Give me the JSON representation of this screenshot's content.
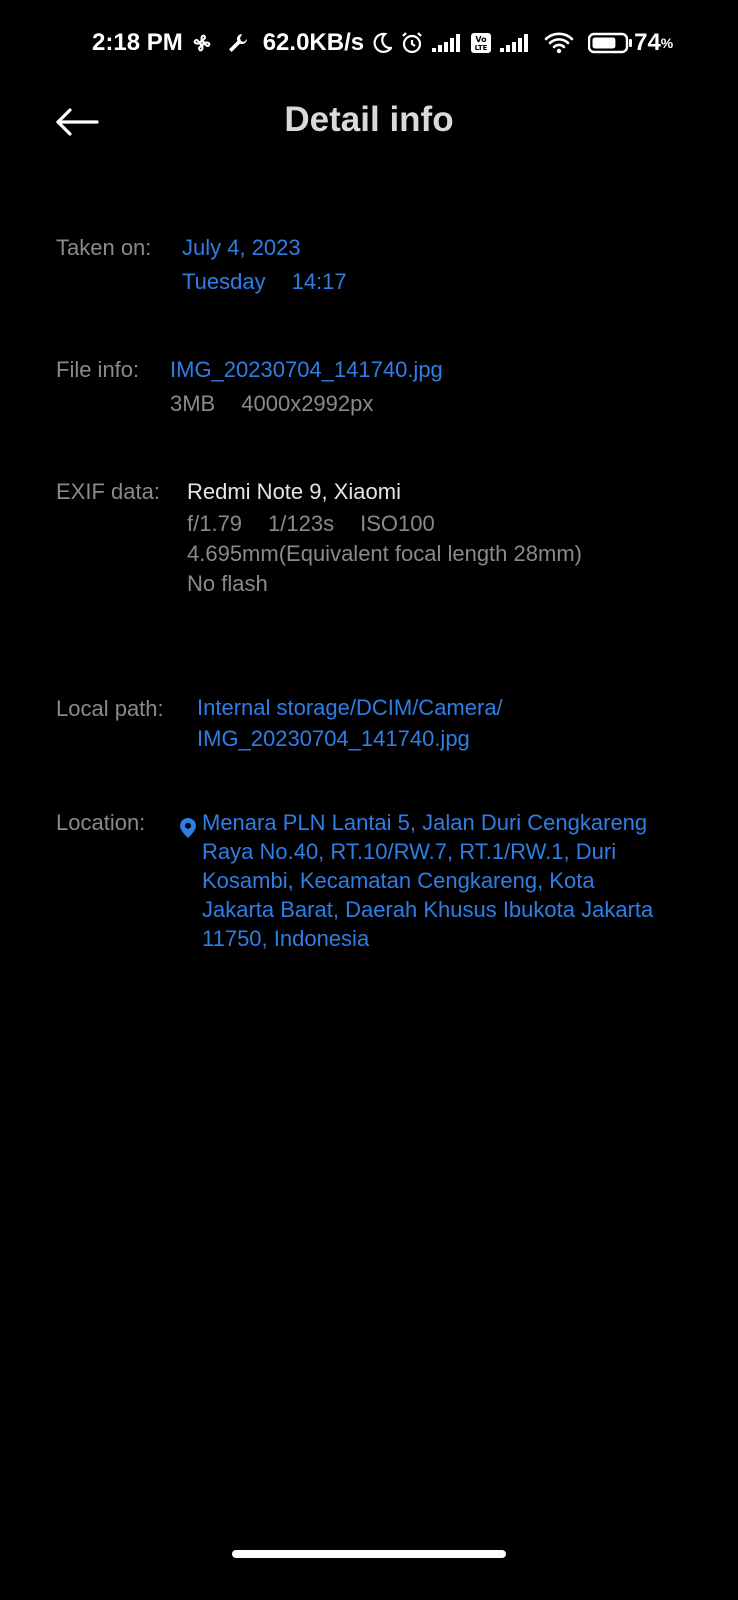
{
  "status_bar": {
    "time": "2:18 PM",
    "speed": "62.0KB/s",
    "battery_percent": "74",
    "battery_unit": "%",
    "battery_level": 0.74,
    "icons": [
      "fan-icon",
      "wrench-icon",
      "moon-icon",
      "alarm-icon",
      "signal-icon",
      "volte-icon",
      "signal-icon",
      "wifi-icon",
      "battery-icon"
    ]
  },
  "header": {
    "title": "Detail info",
    "back_icon": "back-arrow-icon"
  },
  "taken_on": {
    "label": "Taken on:",
    "date": "July 4, 2023",
    "weekday": "Tuesday",
    "time": "14:17"
  },
  "file_info": {
    "label": "File info:",
    "filename": "IMG_20230704_141740.jpg",
    "size": "3MB",
    "resolution": "4000x2992px"
  },
  "exif": {
    "label": "EXIF data:",
    "device": "Redmi Note 9, Xiaomi",
    "aperture": "f/1.79",
    "shutter": "1/123s",
    "iso": "ISO100",
    "focal": "4.695mm(Equivalent focal length 28mm)",
    "flash": "No flash"
  },
  "local_path": {
    "label": "Local path:",
    "line1": "Internal storage/DCIM/Camera/",
    "line2": "IMG_20230704_141740.jpg"
  },
  "location": {
    "label": "Location:",
    "address": "Menara PLN Lantai 5, Jalan Duri Cengkareng Raya No.40, RT.10/RW.7, RT.1/RW.1, Duri Kosambi, Kecamatan Cengkareng, Kota Jakarta Barat, Daerah Khusus Ibukota Jakarta 11750, Indonesia",
    "icon": "location-pin-icon"
  },
  "colors": {
    "background": "#000000",
    "accent_blue": "#2f7ee6",
    "label_gray": "#8a8a8a"
  }
}
